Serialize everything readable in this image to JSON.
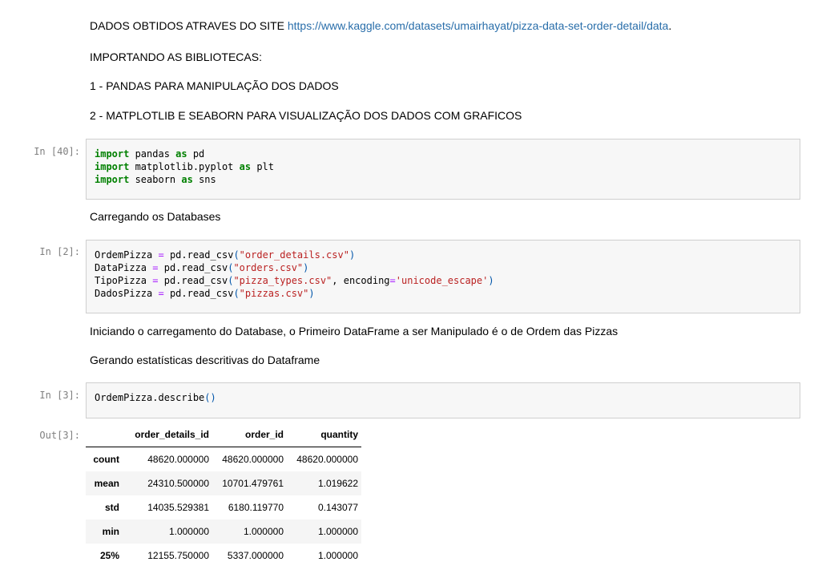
{
  "markdown": {
    "source_prefix": "DADOS OBTIDOS ATRAVES DO SITE ",
    "source_link": "https://www.kaggle.com/datasets/umairhayat/pizza-data-set-order-detail/data",
    "source_suffix": ".",
    "importing": "IMPORTANDO AS BIBLIOTECAS:",
    "lib1": "1 - PANDAS PARA MANIPULAÇÃO DOS DADOS",
    "lib2": "2 - MATPLOTLIB E SEABORN PARA VISUALIZAÇÃO DOS DADOS COM GRAFICOS",
    "loading": "Carregando os Databases",
    "starting": "Iniciando o carregamento do Database, o Primeiro DataFrame a ser Manipulado é o de Ordem das Pizzas",
    "describe_intro": "Gerando estatísticas descritivas do Dataframe"
  },
  "cells": {
    "c1": {
      "prompt": "In [40]:",
      "lines": [
        [
          "import",
          " pandas ",
          "as",
          " pd"
        ],
        [
          "import",
          " matplotlib.pyplot ",
          "as",
          " plt"
        ],
        [
          "import",
          " seaborn ",
          "as",
          " sns"
        ]
      ]
    },
    "c2": {
      "prompt": "In [2]:",
      "l1": {
        "var": "OrdemPizza",
        "call": "pd.read_csv",
        "arg": "\"order_details.csv\""
      },
      "l2": {
        "var": "DataPizza",
        "call": "pd.read_csv",
        "arg": "\"orders.csv\""
      },
      "l3": {
        "var": "TipoPizza",
        "call": "pd.read_csv",
        "arg": "\"pizza_types.csv\"",
        "kwarg": "encoding",
        "kwval": "'unicode_escape'"
      },
      "l4": {
        "var": "DadosPizza",
        "call": "pd.read_csv",
        "arg": "\"pizzas.csv\""
      }
    },
    "c3": {
      "prompt": "In [3]:",
      "code": "OrdemPizza.describe"
    },
    "out3": {
      "prompt": "Out[3]:"
    }
  },
  "table": {
    "columns": [
      "",
      "order_details_id",
      "order_id",
      "quantity"
    ],
    "rows": [
      {
        "index": "count",
        "values": [
          "48620.000000",
          "48620.000000",
          "48620.000000"
        ]
      },
      {
        "index": "mean",
        "values": [
          "24310.500000",
          "10701.479761",
          "1.019622"
        ]
      },
      {
        "index": "std",
        "values": [
          "14035.529381",
          "6180.119770",
          "0.143077"
        ]
      },
      {
        "index": "min",
        "values": [
          "1.000000",
          "1.000000",
          "1.000000"
        ]
      },
      {
        "index": "25%",
        "values": [
          "12155.750000",
          "5337.000000",
          "1.000000"
        ]
      }
    ]
  },
  "colors": {
    "keyword": "#008000",
    "string": "#ba2121",
    "operator": "#aa22ff",
    "link": "#296eaa",
    "prompt": "#7f7f7f",
    "cell_bg": "#f7f7f7",
    "cell_border": "#cfcfcf"
  }
}
